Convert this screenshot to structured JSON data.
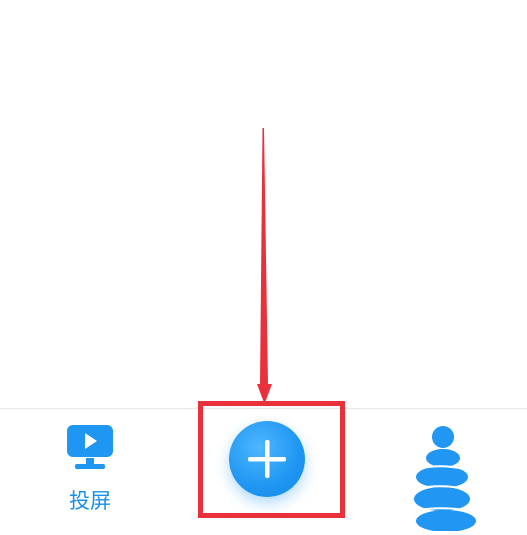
{
  "tab_bar": {
    "cast_label": "投屏",
    "add_icon": "plus-icon",
    "cast_icon": "cast-screen-icon",
    "profile_icon": "profile-avatar-icon"
  },
  "annotation": {
    "color": "#e8313b",
    "highlight_target": "add-button"
  },
  "colors": {
    "accent": "#1e96f2",
    "label": "#1a8fe6",
    "annotation": "#e8313b"
  }
}
